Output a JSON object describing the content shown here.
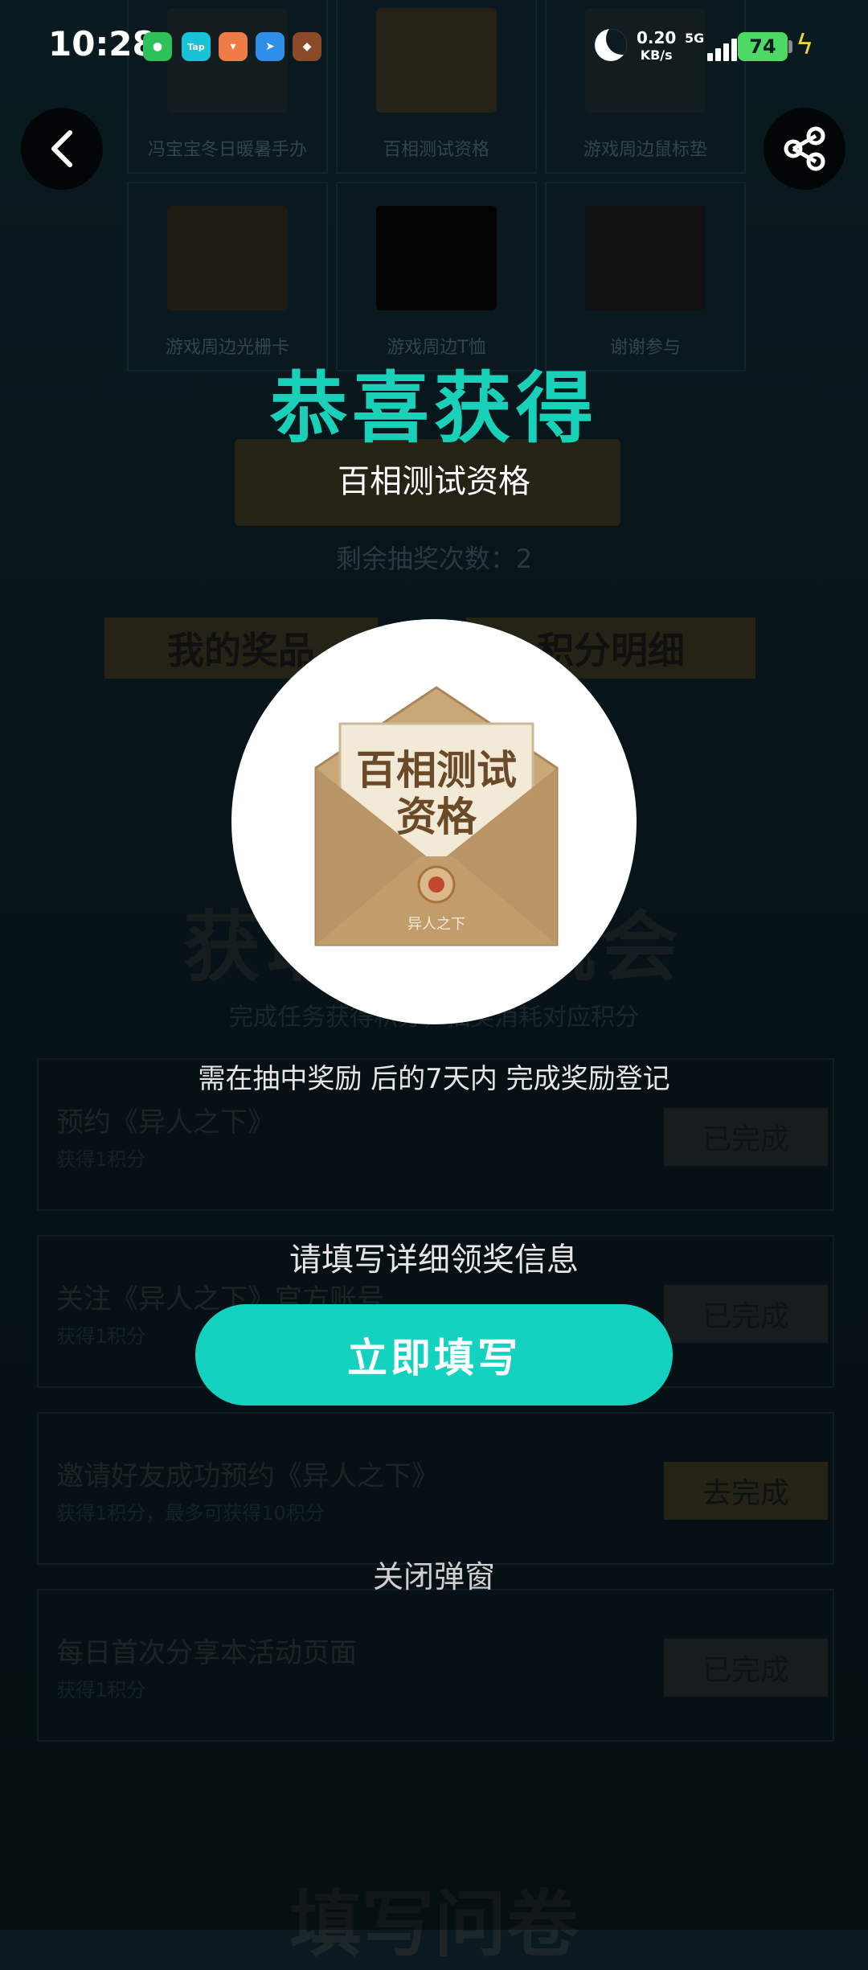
{
  "status_bar": {
    "time": "10:28",
    "net_speed_value": "0.20",
    "net_speed_unit": "KB/s",
    "network_type": "5G",
    "battery": "74",
    "app_icons": [
      "wechat-icon",
      "taptap-icon",
      "orange-app-icon",
      "paper-plane-app-icon",
      "game-app-icon"
    ]
  },
  "background_page": {
    "prizes": [
      {
        "label": "冯宝宝冬日暖暑手办",
        "icon": "figure-icon"
      },
      {
        "label": "百相测试资格",
        "icon": "envelope-icon"
      },
      {
        "label": "游戏周边鼠标垫",
        "icon": "mousepad-icon"
      },
      {
        "label": "游戏周边光栅卡",
        "icon": "cards-icon"
      },
      {
        "label": "游戏周边T恤",
        "icon": "tshirt-icon"
      },
      {
        "label": "谢谢参与",
        "icon": "character-icon"
      }
    ],
    "remaining_draws": "剩余抽奖次数：2",
    "tab_my_prizes": "我的奖品",
    "tab_points_detail": "积分明细",
    "section_heading": "获取抽奖机会",
    "section_subheading": "完成任务获得积分，抽奖消耗对应积分",
    "tasks": [
      {
        "title": "预约《异人之下》",
        "desc": "获得1积分",
        "button": "已完成"
      },
      {
        "title": "关注《异人之下》官方账号",
        "desc": "获得1积分",
        "button": "已完成"
      },
      {
        "title": "邀请好友成功预约《异人之下》",
        "desc": "获得1积分，最多可获得10积分",
        "button": "去完成"
      },
      {
        "title": "每日首次分享本活动页面",
        "desc": "获得1积分",
        "button": "已完成"
      }
    ],
    "bottom_heading": "填写问卷"
  },
  "modal": {
    "congrats": "恭喜获得",
    "prize_name": "百相测试资格",
    "envelope_text_line1": "百相测试",
    "envelope_text_line2": "资格",
    "envelope_seal_text": "异人之下",
    "notice": "需在抽中奖励 后的7天内 完成奖励登记",
    "fill_prompt": "请填写详细领奖信息",
    "fill_button": "立即填写",
    "close": "关闭弹窗"
  },
  "colors": {
    "accent": "#13d2c0",
    "congrats": "#19d0b8",
    "battery": "#4cd964"
  }
}
